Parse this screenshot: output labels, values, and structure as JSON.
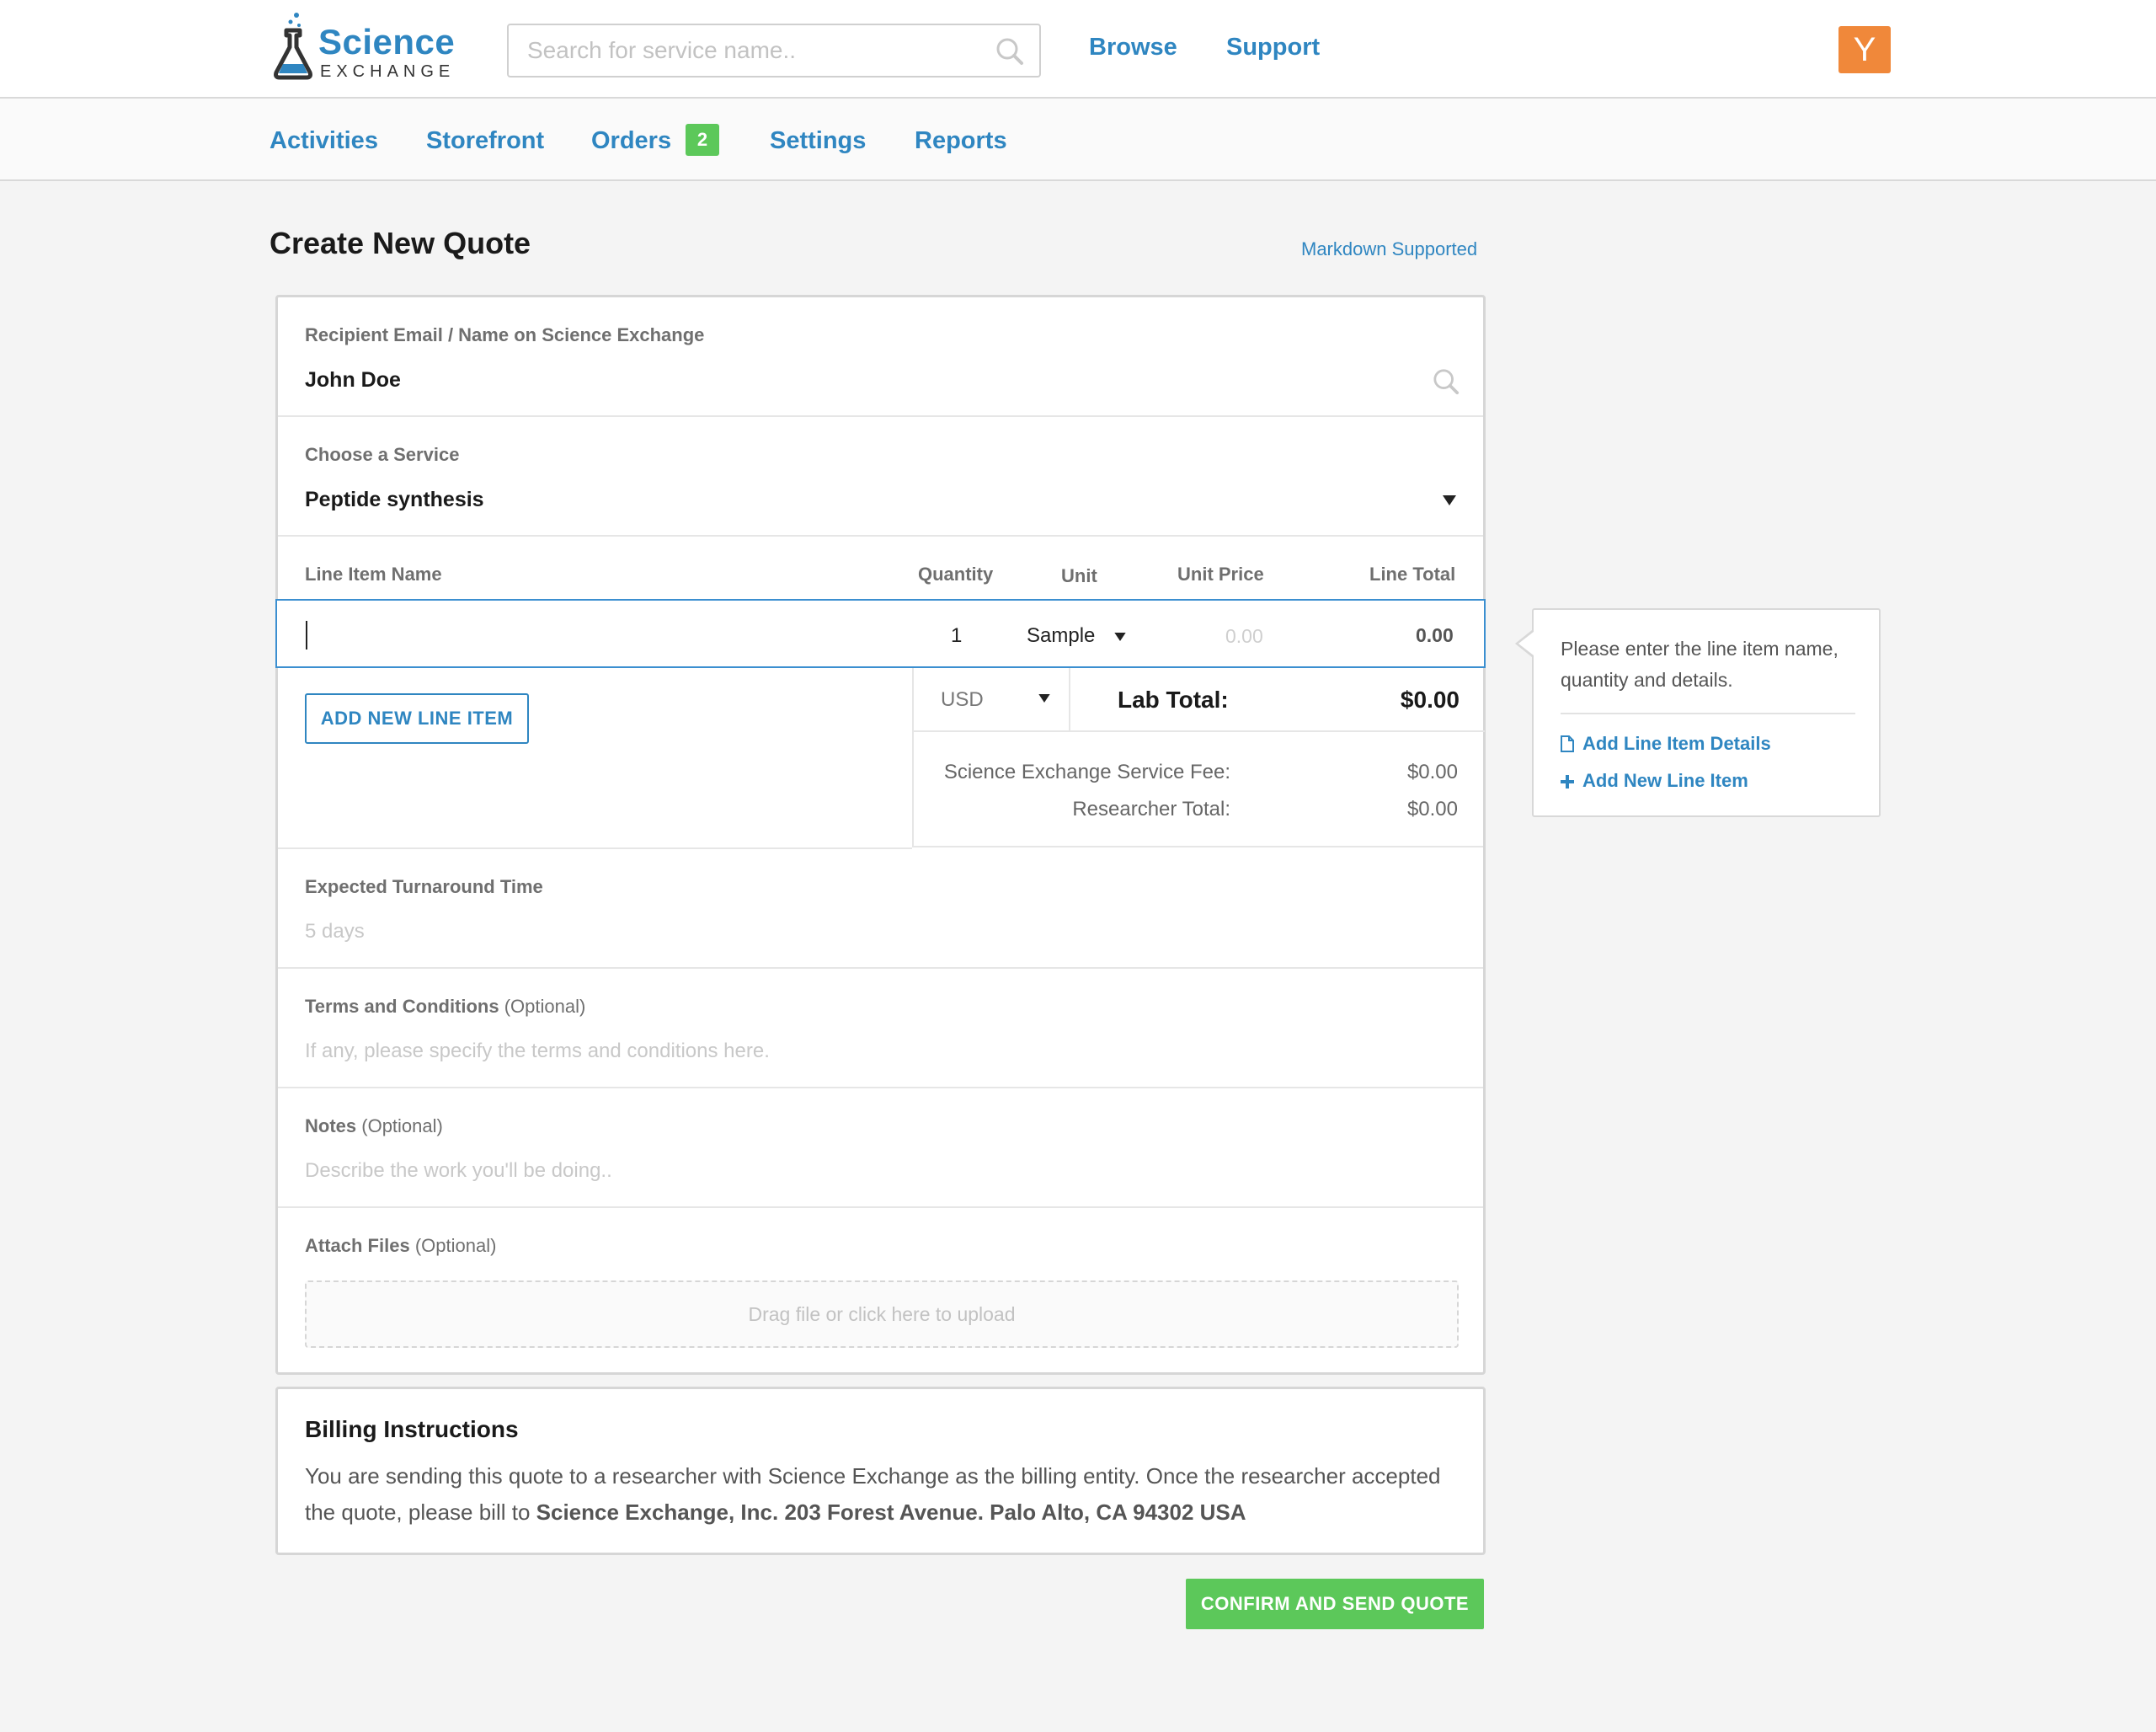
{
  "header": {
    "logo_title": "Science",
    "logo_subtitle": "EXCHANGE",
    "search_placeholder": "Search for service name..",
    "links": [
      "Browse",
      "Support"
    ],
    "avatar_initial": "Y",
    "avatar_color": "#f0883a"
  },
  "subnav": {
    "items": [
      "Activities",
      "Storefront",
      "Orders",
      "Settings",
      "Reports"
    ],
    "orders_badge": "2"
  },
  "page": {
    "title": "Create New Quote",
    "markdown_link": "Markdown Supported"
  },
  "form": {
    "recipient_label": "Recipient Email / Name on Science Exchange",
    "recipient_value": "John Doe",
    "service_label": "Choose a Service",
    "service_value": "Peptide synthesis",
    "columns": {
      "name": "Line Item Name",
      "quantity": "Quantity",
      "unit": "Unit",
      "unit_price": "Unit Price",
      "line_total": "Line Total"
    },
    "line_item": {
      "name": "",
      "quantity": "1",
      "unit": "Sample",
      "unit_price_placeholder": "0.00",
      "line_total": "0.00"
    },
    "add_line_button": "ADD NEW LINE ITEM",
    "currency": "USD",
    "lab_total_label": "Lab Total:",
    "lab_total_value": "$0.00",
    "service_fee_label": "Science Exchange Service Fee:",
    "service_fee_value": "$0.00",
    "researcher_total_label": "Researcher Total:",
    "researcher_total_value": "$0.00",
    "turnaround_label": "Expected Turnaround Time",
    "turnaround_placeholder": "5 days",
    "terms_label": "Terms and Conditions",
    "terms_optional": "(Optional)",
    "terms_placeholder": "If any, please specify the terms and conditions here.",
    "notes_label": "Notes",
    "notes_optional": "(Optional)",
    "notes_placeholder": "Describe the work you'll be doing..",
    "attach_label": "Attach Files",
    "attach_optional": "(Optional)",
    "attach_drop": "Drag file or click here to upload"
  },
  "tooltip": {
    "text": "Please enter the line item name, quantity and details.",
    "add_details": "Add Line Item Details",
    "add_item": "Add New Line Item"
  },
  "billing": {
    "title": "Billing Instructions",
    "text": "You are sending this quote to a researcher with Science Exchange as the billing entity. Once the researcher accepted the quote, please bill to ",
    "address": "Science Exchange, Inc. 203 Forest Avenue. Palo Alto, CA 94302 USA"
  },
  "confirm_button": "CONFIRM AND SEND QUOTE",
  "colors": {
    "accent": "#2f86c1",
    "success": "#5cc85a"
  }
}
